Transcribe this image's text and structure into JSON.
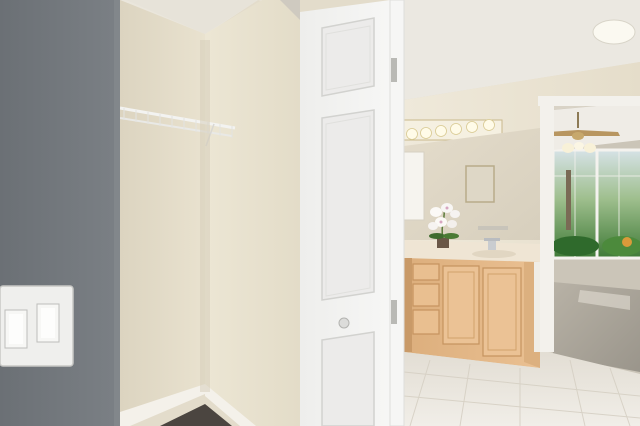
{
  "scene": {
    "kind": "photo",
    "subject": "closet-and-bathroom",
    "colors": {
      "left_wall": "#6f7479",
      "closet_wall": "#e6dfcc",
      "door": "#f1f1f0",
      "ceiling": "#ece9e2",
      "bath_wall": "#ede6d6",
      "cabinet": "#e6b987",
      "tile_floor": "#ece9e3",
      "bedroom_floor": "#a9a49a",
      "greenery": "#3f7a37"
    },
    "icons": {
      "switch_plate": "light-switch-plate-icon",
      "vanity_lights": "vanity-light-bar-icon",
      "ceiling_fan": "ceiling-fan-icon",
      "orchid": "orchid-plant-icon",
      "faucet": "faucet-icon"
    }
  }
}
